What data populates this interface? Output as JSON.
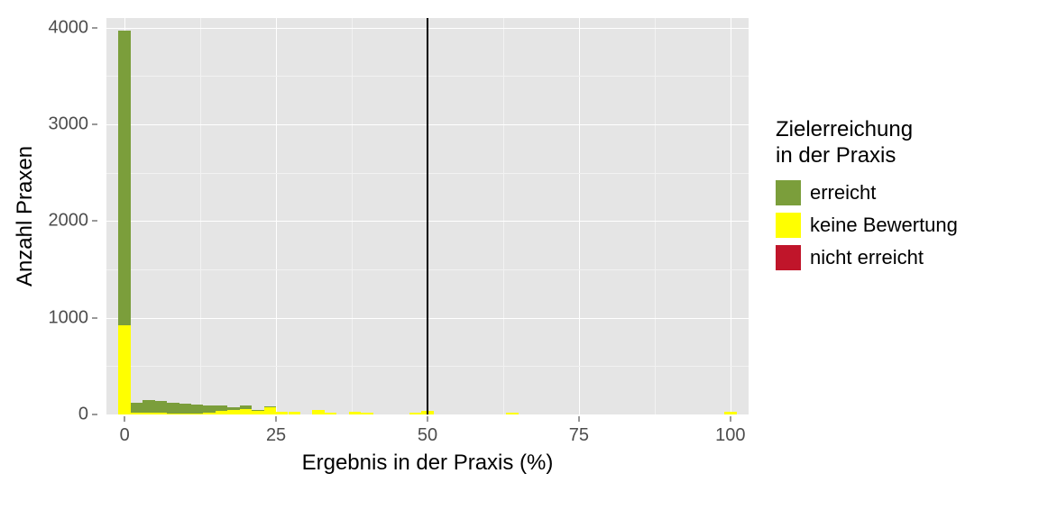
{
  "chart_data": {
    "type": "bar",
    "stacking": "stacked",
    "xlabel": "Ergebnis in der Praxis (%)",
    "ylabel": "Anzahl Praxen",
    "xlim": [
      -3,
      103
    ],
    "ylim": [
      0,
      4100
    ],
    "x_ticks": [
      0,
      25,
      50,
      75,
      100
    ],
    "y_ticks": [
      0,
      1000,
      2000,
      3000,
      4000
    ],
    "vline_x": 50,
    "bin_width": 2,
    "legend": {
      "title": "Zielerreichung\nin der Praxis",
      "items": [
        {
          "key": "erreicht",
          "label": "erreicht",
          "color": "#7b9e3b"
        },
        {
          "key": "keine",
          "label": "keine Bewertung",
          "color": "#ffff00"
        },
        {
          "key": "nicht",
          "label": "nicht erreicht",
          "color": "#c0152a"
        }
      ]
    },
    "bins": [
      {
        "x": 0,
        "erreicht": 3050,
        "keine": 920,
        "nicht": 0
      },
      {
        "x": 2,
        "erreicht": 100,
        "keine": 20,
        "nicht": 0
      },
      {
        "x": 4,
        "erreicht": 130,
        "keine": 15,
        "nicht": 0
      },
      {
        "x": 6,
        "erreicht": 125,
        "keine": 15,
        "nicht": 0
      },
      {
        "x": 8,
        "erreicht": 110,
        "keine": 12,
        "nicht": 0
      },
      {
        "x": 10,
        "erreicht": 105,
        "keine": 10,
        "nicht": 0
      },
      {
        "x": 12,
        "erreicht": 90,
        "keine": 12,
        "nicht": 0
      },
      {
        "x": 14,
        "erreicht": 80,
        "keine": 15,
        "nicht": 0
      },
      {
        "x": 16,
        "erreicht": 55,
        "keine": 35,
        "nicht": 0
      },
      {
        "x": 18,
        "erreicht": 30,
        "keine": 45,
        "nicht": 0
      },
      {
        "x": 20,
        "erreicht": 30,
        "keine": 60,
        "nicht": 0
      },
      {
        "x": 22,
        "erreicht": 10,
        "keine": 35,
        "nicht": 0
      },
      {
        "x": 24,
        "erreicht": 15,
        "keine": 70,
        "nicht": 0
      },
      {
        "x": 26,
        "erreicht": 0,
        "keine": 30,
        "nicht": 0
      },
      {
        "x": 28,
        "erreicht": 0,
        "keine": 25,
        "nicht": 0
      },
      {
        "x": 32,
        "erreicht": 0,
        "keine": 45,
        "nicht": 0
      },
      {
        "x": 34,
        "erreicht": 0,
        "keine": 15,
        "nicht": 0
      },
      {
        "x": 38,
        "erreicht": 0,
        "keine": 30,
        "nicht": 0
      },
      {
        "x": 40,
        "erreicht": 0,
        "keine": 15,
        "nicht": 0
      },
      {
        "x": 48,
        "erreicht": 0,
        "keine": 20,
        "nicht": 0
      },
      {
        "x": 50,
        "erreicht": 0,
        "keine": 35,
        "nicht": 0
      },
      {
        "x": 64,
        "erreicht": 0,
        "keine": 15,
        "nicht": 0
      },
      {
        "x": 100,
        "erreicht": 0,
        "keine": 30,
        "nicht": 0
      }
    ]
  }
}
